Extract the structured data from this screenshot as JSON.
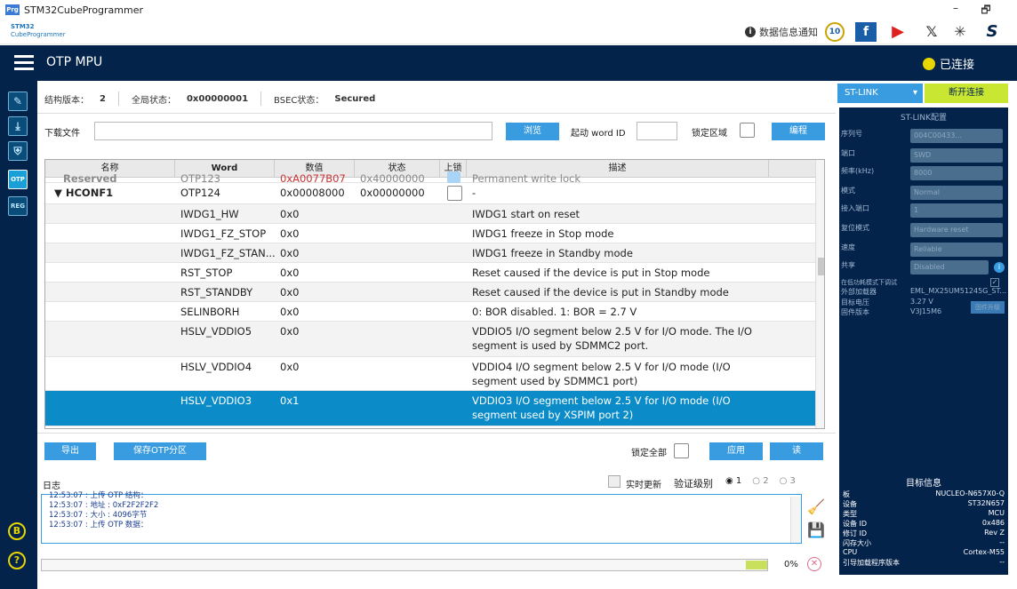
{
  "app": {
    "title": "STM32CubeProgrammer",
    "icon_text": "Prg"
  },
  "window": {
    "minimize": "–",
    "maximize": "🗗"
  },
  "brand": {
    "logo_line1": "STM32",
    "logo_line2": "CubeProgrammer",
    "notification": "数据信息通知"
  },
  "header": {
    "title": "OTP MPU",
    "status": "已连接",
    "status_color": "#e8d600"
  },
  "sidebar": {
    "items": [
      "",
      "",
      "",
      "OTP",
      "REG"
    ],
    "bottom_icon": "B",
    "help_icon": "?"
  },
  "info": {
    "struct_label": "结构版本：",
    "struct_value": "2",
    "global_label": "全局状态：",
    "global_value": "0x00000001",
    "bsec_label": "BSEC状态：",
    "bsec_value": "Secured"
  },
  "download": {
    "label": "下载文件",
    "browse": "浏览",
    "start_word_label": "起动 word ID",
    "lock_area_label": "锁定区域",
    "program": "编程"
  },
  "table": {
    "headers": [
      "名称",
      "Word",
      "数值",
      "状态",
      "上锁",
      "描述"
    ],
    "rows": [
      {
        "name": "Reserved",
        "word": "OTP123",
        "value": "0xA0077B07",
        "state": "0x40000000",
        "desc": "Permanent write lock",
        "lock": "checked"
      },
      {
        "name": "HCONF1",
        "word": "OTP124",
        "value": "0x00008000",
        "state": "0x00000000",
        "desc": "-",
        "lock": "unchecked"
      },
      {
        "name": "",
        "word": "IWDG1_HW",
        "value": "0x0",
        "state": "",
        "desc": "IWDG1 start on reset",
        "lock": ""
      },
      {
        "name": "",
        "word": "IWDG1_FZ_STOP",
        "value": "0x0",
        "state": "",
        "desc": "IWDG1 freeze in Stop mode",
        "lock": ""
      },
      {
        "name": "",
        "word": "IWDG1_FZ_STAN...",
        "value": "0x0",
        "state": "",
        "desc": "IWDG1 freeze in Standby mode",
        "lock": ""
      },
      {
        "name": "",
        "word": "RST_STOP",
        "value": "0x0",
        "state": "",
        "desc": "Reset caused if the device is put in Stop mode",
        "lock": ""
      },
      {
        "name": "",
        "word": "RST_STANDBY",
        "value": "0x0",
        "state": "",
        "desc": "Reset caused if the device is put in Standby mode",
        "lock": ""
      },
      {
        "name": "",
        "word": "SELINBORH",
        "value": "0x0",
        "state": "",
        "desc": "0: BOR disabled. 1: BOR = 2.7 V",
        "lock": ""
      },
      {
        "name": "",
        "word": "HSLV_VDDIO5",
        "value": "0x0",
        "state": "",
        "desc": "VDDIO5 I/O segment below 2.5 V for I/O mode. The I/O segment is used by SDMMC2 port.",
        "lock": ""
      },
      {
        "name": "",
        "word": "HSLV_VDDIO4",
        "value": "0x0",
        "state": "",
        "desc": "VDDIO4 I/O segment below 2.5 V for I/O mode (I/O segment used by SDMMC1 port)",
        "lock": ""
      },
      {
        "name": "",
        "word": "HSLV_VDDIO3",
        "value": "0x1",
        "state": "",
        "desc": "VDDIO3 I/O segment below 2.5 V for I/O mode (I/O segment used by XSPIM port 2)",
        "lock": ""
      }
    ]
  },
  "actions": {
    "export": "导出",
    "save_partition": "保存OTP分区",
    "lock_all": "锁定全部",
    "apply": "应用",
    "read": "读"
  },
  "log": {
    "title": "日志",
    "realtime": "实时更新",
    "verbosity": "验证级别",
    "levels": [
      "1",
      "2",
      "3"
    ],
    "lines": [
      "12:53:07 : 上传 OTP 结构：",
      "12:53:07 :  地址     : 0xF2F2F2F2",
      "12:53:07 :  大小       : 4096字节",
      "12:53:07 : 上传 OTP 数据："
    ],
    "progress": "0%"
  },
  "stlink": {
    "selector": "ST-LINK",
    "disconnect": "断开连接",
    "config_title": "ST-LINK配置",
    "fields": [
      {
        "label": "序列号",
        "value": "004C00433..."
      },
      {
        "label": "端口",
        "value": "SWD"
      },
      {
        "label": "频率(kHz)",
        "value": "8000"
      },
      {
        "label": "模式",
        "value": "Normal"
      },
      {
        "label": "接入端口",
        "value": "1"
      },
      {
        "label": "复位模式",
        "value": "Hardware reset"
      },
      {
        "label": "速度",
        "value": "Reliable"
      },
      {
        "label": "共享",
        "value": "Disabled"
      }
    ],
    "debug_low_power": "在低功耗模式下调试",
    "ext_loader_label": "外部加载器",
    "ext_loader_value": "EML_MX25UM51245G_ST...",
    "target_voltage_label": "目标电压",
    "target_voltage_value": "3.27 V",
    "firmware_label": "固件版本",
    "firmware_value": "V3J15M6",
    "firmware_update": "固件升级"
  },
  "target": {
    "title": "目标信息",
    "rows": [
      {
        "label": "板",
        "value": "NUCLEO-N657X0-Q"
      },
      {
        "label": "设备",
        "value": "ST32N657"
      },
      {
        "label": "类型",
        "value": "MCU"
      },
      {
        "label": "设备 ID",
        "value": "0x486"
      },
      {
        "label": "修订 ID",
        "value": "Rev Z"
      },
      {
        "label": "闪存大小",
        "value": "--"
      },
      {
        "label": "CPU",
        "value": "Cortex-M55"
      },
      {
        "label": "引导加载程序版本",
        "value": "--"
      }
    ]
  }
}
